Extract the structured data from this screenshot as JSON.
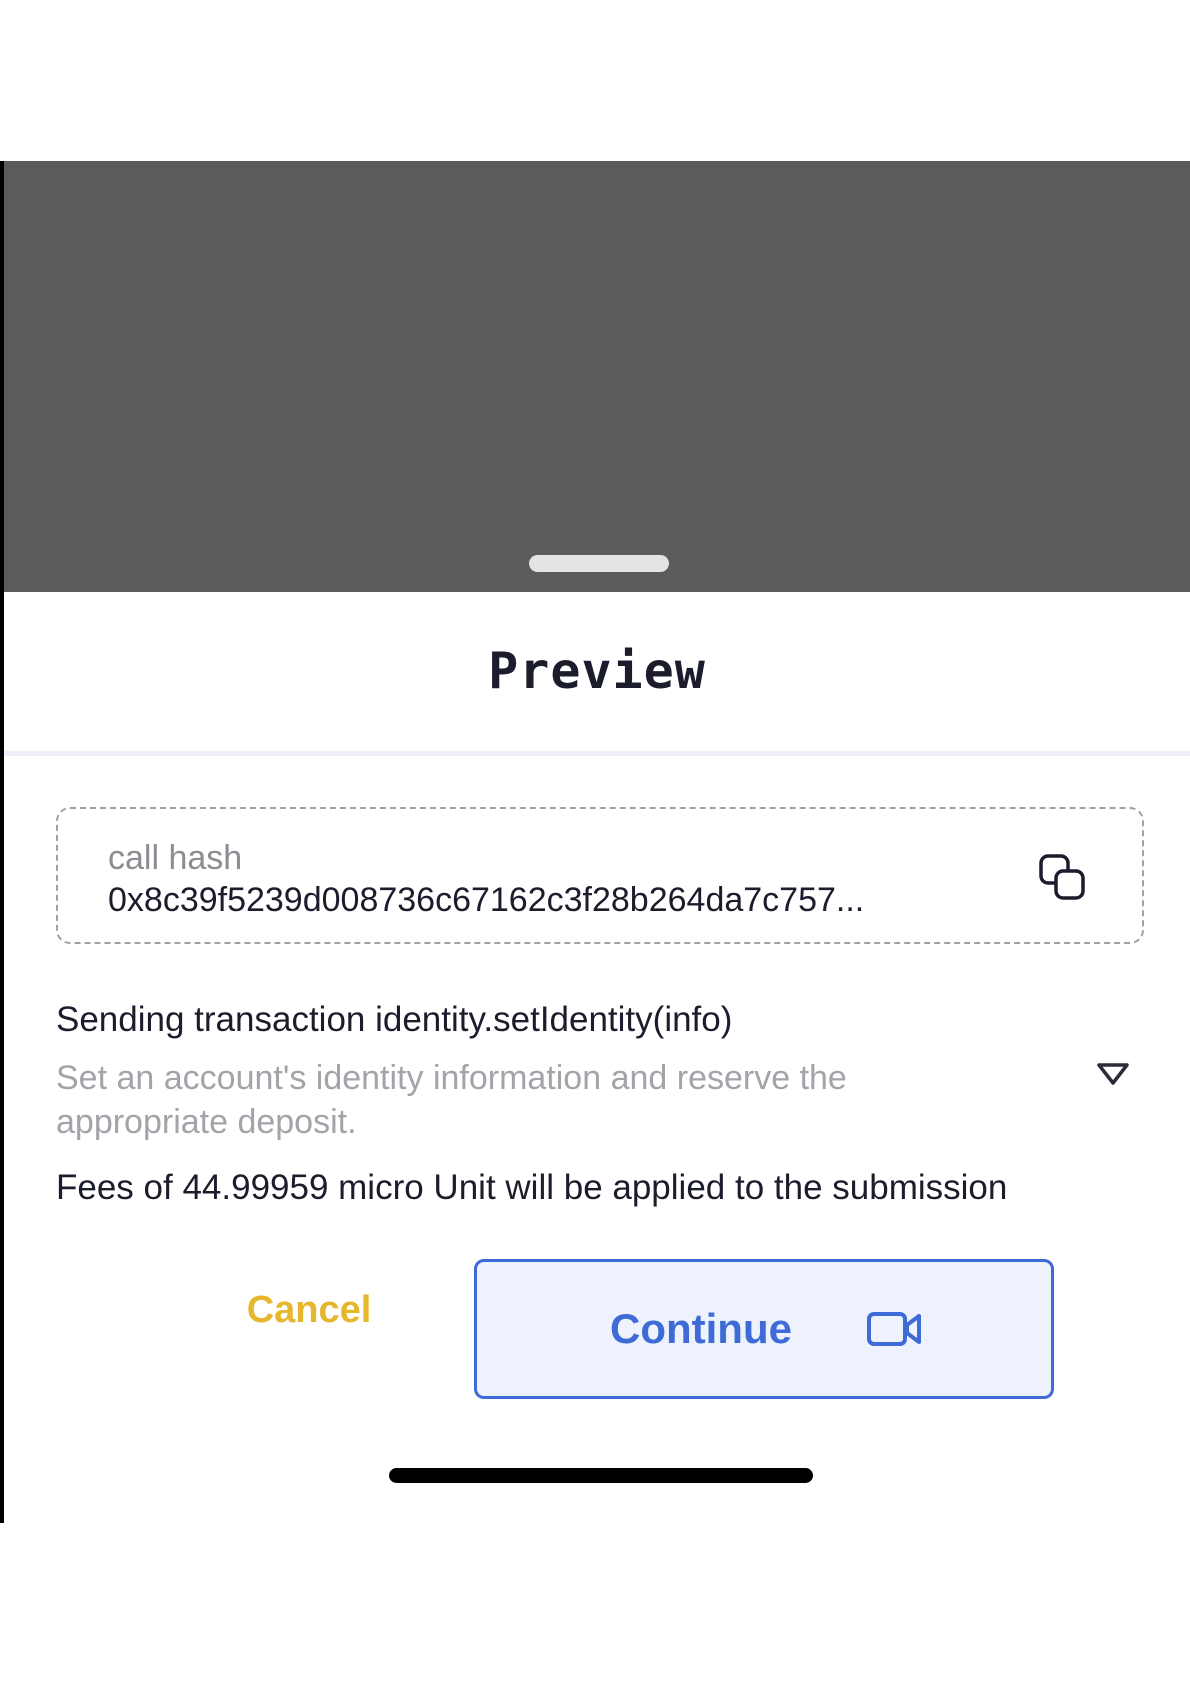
{
  "sheet": {
    "title": "Preview"
  },
  "call_hash": {
    "label": "call hash",
    "value": "0x8c39f5239d008736c67162c3f28b264da7c757...",
    "icon": "copy-icon"
  },
  "transaction": {
    "title": "Sending transaction identity.setIdentity(info)",
    "description": "Set an account's identity information and reserve the appropriate deposit.",
    "expand_icon": "triangle-down-icon"
  },
  "fees": {
    "text": "Fees of 44.99959 micro Unit will be applied to the submission"
  },
  "actions": {
    "cancel_label": "Cancel",
    "continue_label": "Continue",
    "continue_icon": "video-camera-icon"
  },
  "colors": {
    "overlay": "#5b5a5d",
    "title_text": "#1b1d2d",
    "muted_text": "#a3a4aa",
    "cancel": "#e6b62d",
    "accent": "#3e6bd6",
    "continue_bg": "#eef2fd"
  }
}
